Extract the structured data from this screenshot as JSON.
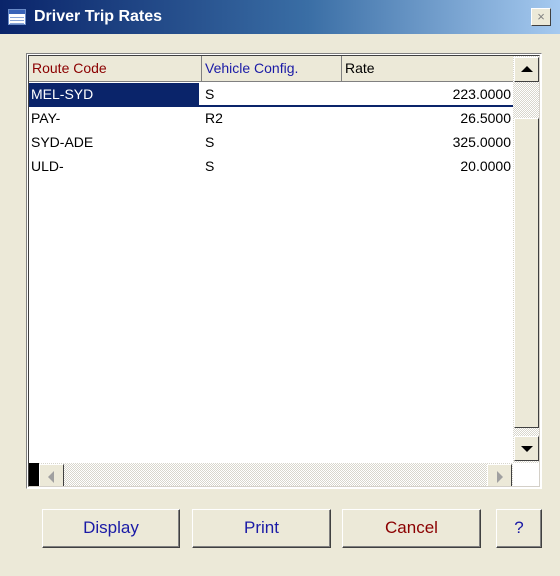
{
  "window": {
    "title": "Driver Trip Rates",
    "close_label": "×"
  },
  "colors": {
    "route_header": "#8b0000",
    "vehicle_header": "#1a1aa6",
    "rate_header": "#000000",
    "display_btn": "#1a1aa6",
    "print_btn": "#1a1aa6",
    "cancel_btn": "#8b0000",
    "help_btn": "#1a1aa6"
  },
  "grid": {
    "columns": [
      "Route Code",
      "Vehicle Config.",
      "Rate"
    ],
    "rows": [
      {
        "route": "MEL-SYD",
        "config": "S",
        "rate": "223.0000"
      },
      {
        "route": "PAY-",
        "config": "R2",
        "rate": "26.5000"
      },
      {
        "route": "SYD-ADE",
        "config": "S",
        "rate": "325.0000"
      },
      {
        "route": "ULD-",
        "config": "S",
        "rate": "20.0000"
      }
    ],
    "selected_row": 0
  },
  "buttons": {
    "display": "Display",
    "print": "Print",
    "cancel": "Cancel",
    "help": "?"
  }
}
